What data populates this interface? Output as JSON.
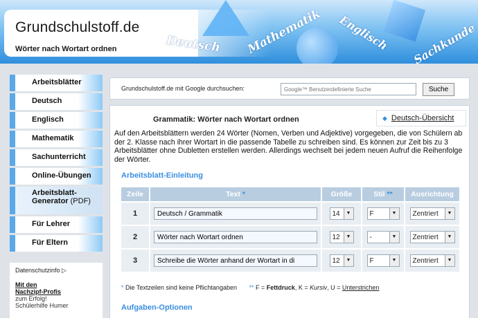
{
  "header": {
    "title": "Grundschulstoff.de",
    "subtitle": "Wörter nach Wortart ordnen",
    "subjects": [
      "Deutsch",
      "Mathematik",
      "Englisch",
      "Sachkunde"
    ]
  },
  "nav": {
    "items": [
      {
        "label": "Arbeitsblätter"
      },
      {
        "label": "Deutsch"
      },
      {
        "label": "Englisch"
      },
      {
        "label": "Mathematik"
      },
      {
        "label": "Sachunterricht"
      },
      {
        "label": "Online-Übungen"
      },
      {
        "label": "Arbeitsblatt-",
        "label2": "Generator",
        "label3": "(PDF)"
      },
      {
        "label": "Für Lehrer"
      },
      {
        "label": "Für Eltern"
      }
    ]
  },
  "sidebox": {
    "privacy": "Datenschutzinfo ▷",
    "promo_title_1": "Mit den",
    "promo_title_2": "Nachzipf-Profis",
    "promo_line_1": "zum Erfolg!",
    "promo_line_2": "Schülerhilfe Humer"
  },
  "search": {
    "label": "Grundschulstoff.de mit Google durchsuchen:",
    "placeholder": "Google™ Benutzerdefinierte Suche",
    "button": "Suche"
  },
  "main": {
    "title": "Grammatik: Wörter nach Wortart ordnen",
    "overview_link": "Deutsch-Übersicht",
    "description": "Auf den Arbeitsblättern werden 24 Wörter (Nomen, Verben und Adjektive) vorgegeben, die von Schülern ab der 2. Klasse nach ihrer Wortart in die passende Tabelle zu schreiben sind. Es können zur Zeit bis zu 3 Arbeitsblätter ohne Dubletten erstellen werden. Allerdings wechselt bei jedem neuen Aufruf die Reihenfolge der Wörter.",
    "section1": "Arbeitsblatt-Einleitung",
    "section2": "Aufgaben-Optionen",
    "table": {
      "headers": {
        "zeile": "Zeile",
        "text": "Text",
        "groesse": "Größe",
        "stil": "Stil",
        "ausrichtung": "Ausrichtung"
      },
      "header_marks": {
        "text": "*",
        "stil": "**"
      },
      "rows": [
        {
          "nr": "1",
          "text": "Deutsch / Grammatik",
          "size": "14",
          "style": "F",
          "align": "Zentriert"
        },
        {
          "nr": "2",
          "text": "Wörter nach Wortart ordnen",
          "size": "12",
          "style": "-",
          "align": "Zentriert"
        },
        {
          "nr": "3",
          "text": "Schreibe die Wörter anhand der Wortart in di",
          "size": "12",
          "style": "F",
          "align": "Zentriert"
        }
      ]
    },
    "footnote": {
      "star1": "*",
      "note1": "Die Textzeilen sind keine Pflichtangaben",
      "star2": "**",
      "f_prefix": "F =",
      "f_label": "Fettdruck",
      "k_prefix": ",  K =",
      "k_label": "Kursiv",
      "u_prefix": ",  U =",
      "u_label": "Unterstrichen"
    }
  },
  "colors": {
    "accent": "#3a8fe0",
    "header_blue": "#2f8fdc",
    "table_header": "#b8cde0"
  }
}
